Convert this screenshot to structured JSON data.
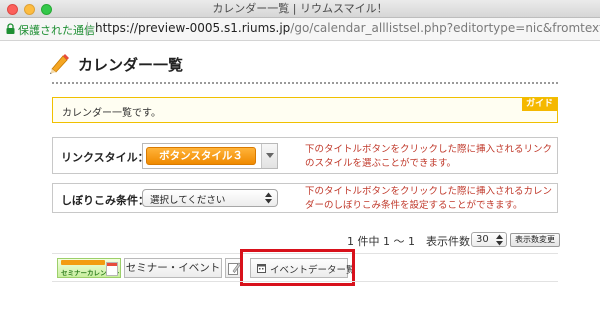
{
  "window": {
    "title": "カレンダー一覧 | リウムスマイル！"
  },
  "addressbar": {
    "secure_label": "保護された通信",
    "url_main": "https://preview-0005.s1.riums.jp",
    "url_rest": "/go/calendar_alllistsel.php?editortype=nic&fromtextareaid=contents."
  },
  "page": {
    "title": "カレンダー一覧"
  },
  "guide": {
    "text": "カレンダー一覧です。",
    "badge": "ガイド"
  },
  "link_style": {
    "label": "リンクスタイル：",
    "selected": "ボタンスタイル３",
    "help": "下のタイトルボタンをクリックした際に挿入されるリンクのスタイルを選ぶことができます。"
  },
  "filter": {
    "label": "しぼりこみ条件：",
    "selected": "選択してください",
    "help": "下のタイトルボタンをクリックした際に挿入されるカレンダーのしぼりこみ条件を設定することができます。"
  },
  "pager": {
    "summary": "1 件中 1 ～ 1　表示件数：",
    "per_page": "30",
    "change_button": "表示数変更"
  },
  "toolbar": {
    "banner_text": "セミナーカレンダー",
    "seminar_event_button": "セミナー・イベント",
    "event_data_button": "イベントデーター覧"
  },
  "colors": {
    "accent_orange": "#f08a00",
    "guide_yellow": "#f5b800",
    "help_red": "#c0392b",
    "highlight_red": "#d8111b",
    "secure_green": "#1e8f33"
  }
}
